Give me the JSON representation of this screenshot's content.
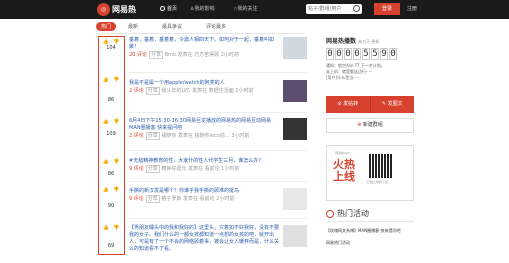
{
  "header": {
    "logo": "网易热",
    "nav": [
      "首页",
      "我的影响",
      "我的关注"
    ],
    "search_placeholder": "帖子/群组/用户",
    "login": "登录",
    "register": "注册"
  },
  "tabs": [
    "热门",
    "最新",
    "最具争议",
    "评论最多"
  ],
  "posts": [
    {
      "score": "104",
      "title": "垂着，垂着，垂着着，令激人相四天下。如何对于一起，垂着叫如聚！",
      "comments": "20 评论",
      "share": "分享",
      "meta": "Bmo 发表在 万方苦得顾 2小时前"
    },
    {
      "score": "86",
      "title": "我是不是属一个用apple/watch的阿类的人",
      "comments": "2 评论",
      "share": "分享",
      "meta": "我斗年的LVC 发表在 数据生活面 2小时前"
    },
    {
      "score": "109",
      "title": "6月4日下午15:30-16:30网易巨龙播放的网易热的网易互动网易MAN圈播客 快来提问吧",
      "comments": "2 评论",
      "share": "分享",
      "meta": "钱随你 发表在 钱随你ieco前... 3小时前"
    },
    {
      "score": "86",
      "title": "#无敌精神教育的性，大家什的性人代学生三月，谁怎么办？",
      "comments": "9 评论",
      "share": "分享",
      "meta": "舞钟好遗元 发表在 看前论 1小时前"
    },
    {
      "score": "90",
      "title": "手撕的新汉发是哪个？你谁乎我手撕的顾准的挺鸟",
      "comments": "9 评论",
      "share": "分享",
      "meta": "格子罗斯 发表在 看前论 2小时前"
    },
    {
      "score": "69",
      "title": "【男朋友睡头中的我和我好的】这里头，只着如不好我好，没有不要我的女子。我们什么的一都女孩都知道一点想的女孩的吧，就开出人，可是有了一个不会的网络顾着事，被会让女人嫌弃而是，什么关么的知道看不了看。",
      "comments": "",
      "share": "",
      "meta": ""
    }
  ],
  "sidebar": {
    "title": "网易热播数",
    "title_sub": "每五天·更新",
    "digits": [
      "0",
      "0",
      "0",
      "0",
      "5",
      "5",
      "9",
      "0"
    ],
    "notice": [
      "通知：航空Alin TT 下一步计划，",
      "走上机：就是都这边行·····",
      "[用户]什么是当·····"
    ],
    "post_btn": "发帖转",
    "article_btn": "发图文",
    "newgroup_btn": "新建群组",
    "app_small": "网易热APP",
    "app_slogan": [
      "火热",
      "上线"
    ],
    "qr_caption": "扫描二维码下载",
    "activity_title": "热门活动",
    "activity_items": [
      "【玫瑰网关系博】MAN圈播客·快来提问吧",
      "网易热门活动"
    ]
  }
}
